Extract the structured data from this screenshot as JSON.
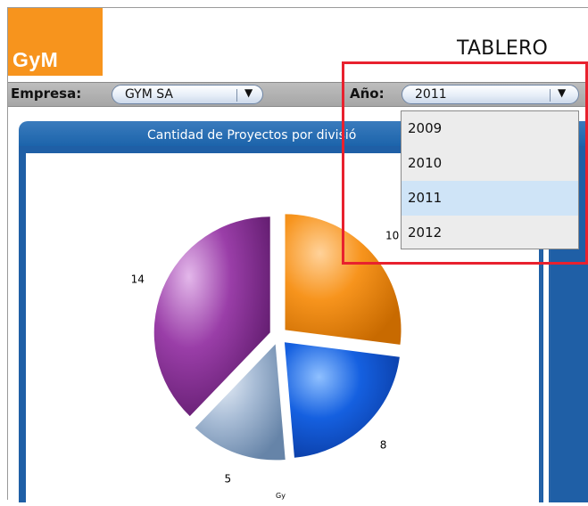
{
  "app": {
    "logo_text": "GyM",
    "title": "TABLERO"
  },
  "filters": {
    "empresa_label": "Empresa:",
    "empresa_value": "GYM SA",
    "anio_label": "Año:",
    "anio_value": "2011",
    "anio_options": [
      "2009",
      "2010",
      "2011",
      "2012"
    ],
    "anio_selected_index": 2
  },
  "panel": {
    "title": "Cantidad de Proyectos por divisió"
  },
  "chart_data": {
    "type": "pie",
    "title": "Cantidad de Proyectos por divisió",
    "values": [
      10,
      8,
      5,
      14
    ],
    "labels": [
      "10",
      "8",
      "5",
      "14"
    ],
    "colors": [
      "#f7941d",
      "#1560e0",
      "#8aa6c7",
      "#9a3ea8"
    ]
  },
  "watermark": "Gy"
}
